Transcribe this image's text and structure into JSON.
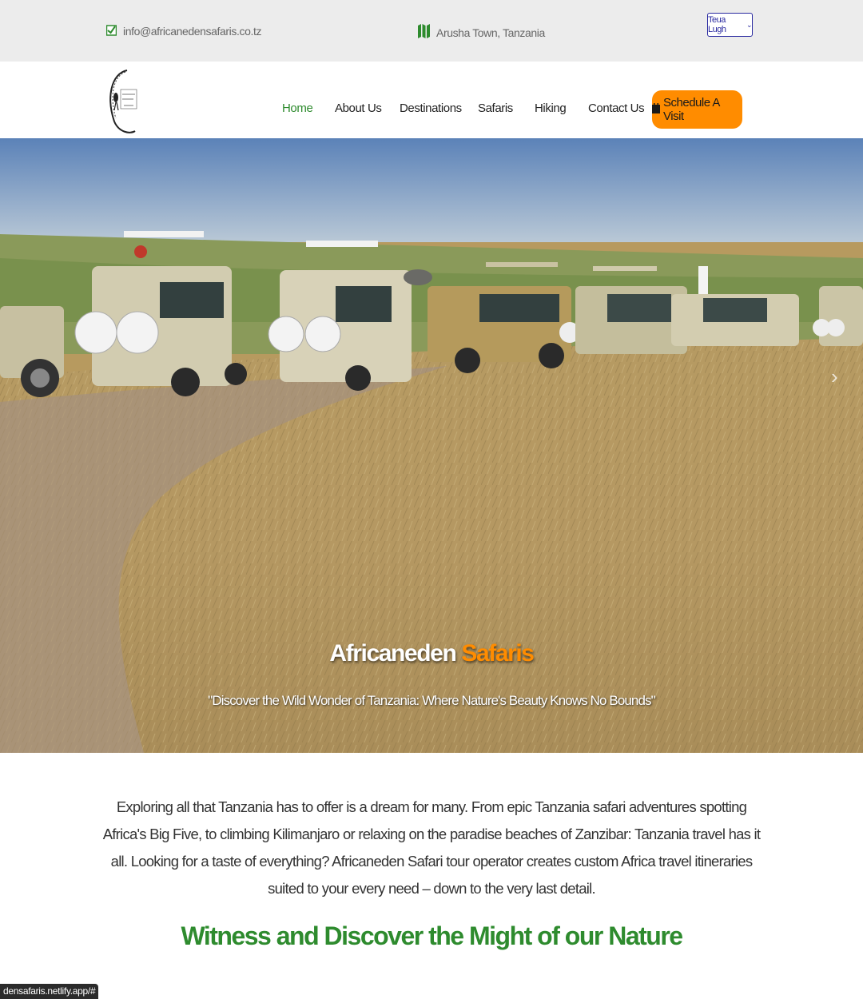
{
  "topbar": {
    "email": "info@africanedensafaris.co.tz",
    "location": "Arusha Town, Tanzania",
    "language": "Teua Lugh",
    "email_icon": "envelope-check-icon",
    "location_icon": "map-icon"
  },
  "nav": {
    "logo_alt": "Africaneden Safaris logo",
    "items": [
      {
        "label": "Home",
        "active": true
      },
      {
        "label": "About Us"
      },
      {
        "label": "Destinations"
      },
      {
        "label": "Safaris"
      },
      {
        "label": "Hiking"
      },
      {
        "label": "Contact Us"
      }
    ],
    "cta_label": "Schedule A Visit",
    "cta_icon": "calendar-icon"
  },
  "hero": {
    "title_main": "Africaneden",
    "title_accent": "Safaris",
    "subtitle": "\"Discover the Wild Wonder of Tanzania: Where Nature's Beauty Knows No Bounds\""
  },
  "intro": {
    "text": "Exploring all that Tanzania has to offer is a dream for many. From epic Tanzania safari adventures spotting Africa's Big Five, to climbing Kilimanjaro or relaxing on the paradise beaches of Zanzibar: Tanzania travel has it all. Looking for a taste of everything? Africaneden Safari tour operator creates custom Africa travel itineraries suited to your every need – down to the very last detail."
  },
  "section": {
    "title": "Witness and Discover the Might of our Nature"
  },
  "status": {
    "url": "densafaris.netlify.app/#"
  },
  "colors": {
    "accent_green": "#2e8b2e",
    "accent_orange": "#ff8c00"
  }
}
